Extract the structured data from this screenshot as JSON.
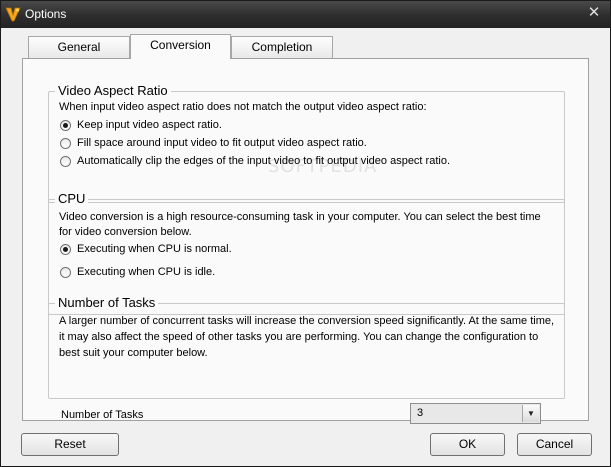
{
  "window": {
    "title": "Options",
    "close_glyph": "✕",
    "app_icon": "app-logo-icon"
  },
  "tabs": [
    {
      "label": "General",
      "active": false
    },
    {
      "label": "Conversion",
      "active": true
    },
    {
      "label": "Completion",
      "active": false
    }
  ],
  "watermark": "SOFTPEDIA",
  "video_aspect": {
    "title": "Video Aspect Ratio",
    "description": "When input video aspect ratio does not match the output video aspect ratio:",
    "options": [
      {
        "label": "Keep input video aspect ratio.",
        "checked": true
      },
      {
        "label": "Fill space around input video to fit output video aspect ratio.",
        "checked": false
      },
      {
        "label": "Automatically clip the edges of the input video to fit output video aspect ratio.",
        "checked": false
      }
    ]
  },
  "cpu": {
    "title": "CPU",
    "description_line1": "Video conversion is a high resource-consuming task in your computer. You can select the best time",
    "description_line2": "for video conversion below.",
    "options": [
      {
        "label": "Executing when CPU is normal.",
        "checked": true
      },
      {
        "label": "Executing when CPU is idle.",
        "checked": false
      }
    ]
  },
  "tasks": {
    "title": "Number of Tasks",
    "description_line1": "A larger number of concurrent tasks will increase the conversion speed significantly. At the same time,",
    "description_line2": "it may also affect the speed of other tasks you are performing. You can change the configuration to",
    "description_line3": "best suit your computer below.",
    "field_label": "Number of Tasks",
    "value": "3",
    "arrow_glyph": "▼"
  },
  "buttons": {
    "reset": "Reset",
    "ok": "OK",
    "cancel": "Cancel"
  }
}
